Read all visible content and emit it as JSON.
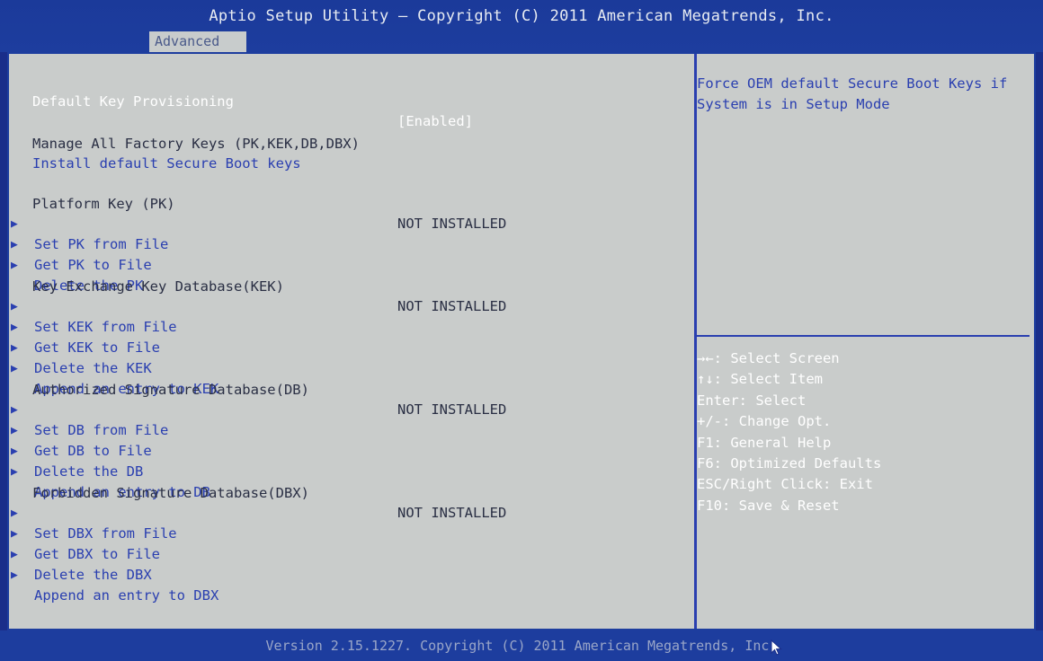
{
  "header": {
    "title": "Aptio Setup Utility – Copyright (C) 2011 American Megatrends, Inc.",
    "active_tab": "Advanced"
  },
  "main": {
    "rows": [
      {
        "label": "Default Key Provisioning",
        "value": "[Enabled]",
        "kind": "selected",
        "arrow": false
      },
      {
        "label": "Manage All Factory Keys (PK,KEK,DB,DBX)",
        "value": "",
        "kind": "static",
        "arrow": false
      },
      {
        "label": "Install default Secure Boot keys",
        "value": "",
        "kind": "link",
        "arrow": false
      },
      {
        "label": "Platform Key (PK)",
        "value": "NOT INSTALLED",
        "kind": "static",
        "arrow": false
      },
      {
        "label": "Set PK from File",
        "value": "",
        "kind": "submenu",
        "arrow": true
      },
      {
        "label": "Get PK to File",
        "value": "",
        "kind": "submenu",
        "arrow": true
      },
      {
        "label": "Delete the PK",
        "value": "",
        "kind": "submenu",
        "arrow": true
      },
      {
        "label": "Key Exchange Key Database(KEK)",
        "value": "NOT INSTALLED",
        "kind": "static",
        "arrow": false
      },
      {
        "label": "Set KEK from File",
        "value": "",
        "kind": "submenu",
        "arrow": true
      },
      {
        "label": "Get KEK to File",
        "value": "",
        "kind": "submenu",
        "arrow": true
      },
      {
        "label": "Delete the KEK",
        "value": "",
        "kind": "submenu",
        "arrow": true
      },
      {
        "label": "Append an entry to KEK",
        "value": "",
        "kind": "submenu",
        "arrow": true
      },
      {
        "label": "Authorized Signature Database(DB)",
        "value": "NOT INSTALLED",
        "kind": "static",
        "arrow": false
      },
      {
        "label": "Set DB from File",
        "value": "",
        "kind": "submenu",
        "arrow": true
      },
      {
        "label": "Get DB to File",
        "value": "",
        "kind": "submenu",
        "arrow": true
      },
      {
        "label": "Delete the DB",
        "value": "",
        "kind": "submenu",
        "arrow": true
      },
      {
        "label": "Append an entry to DB",
        "value": "",
        "kind": "submenu",
        "arrow": true
      },
      {
        "label": "Forbidden Signature Database(DBX)",
        "value": "NOT INSTALLED",
        "kind": "static",
        "arrow": false
      },
      {
        "label": "Set DBX from File",
        "value": "",
        "kind": "submenu",
        "arrow": true
      },
      {
        "label": "Get DBX to File",
        "value": "",
        "kind": "submenu",
        "arrow": true
      },
      {
        "label": "Delete the DBX",
        "value": "",
        "kind": "submenu",
        "arrow": true
      },
      {
        "label": "Append an entry to DBX",
        "value": "",
        "kind": "submenu",
        "arrow": true
      }
    ]
  },
  "help": {
    "text": "Force OEM default Secure Boot Keys if System is in Setup Mode",
    "keys": [
      "→←: Select Screen",
      "↑↓: Select Item",
      "Enter: Select",
      "+/-: Change Opt.",
      "F1: General Help",
      "F6: Optimized Defaults",
      "ESC/Right Click: Exit",
      "F10: Save & Reset"
    ]
  },
  "footer": {
    "version": "Version 2.15.1227. Copyright (C) 2011 American Megatrends, Inc."
  },
  "colors": {
    "header_bg": "#1d3d9e",
    "panel_bg": "#c9cccb",
    "accent_blue": "#2a3fb0",
    "selected_text": "#ffffff"
  },
  "icons": {
    "submenu": "triangle-right-icon",
    "cursor": "mouse-pointer-icon"
  }
}
